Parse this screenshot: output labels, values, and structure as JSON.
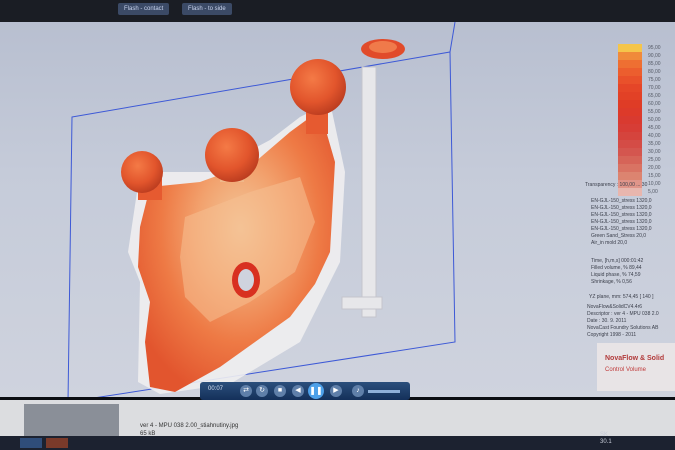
{
  "toolbar": {
    "btn1": "Flash - contact",
    "btn2": "Flash - to side"
  },
  "legend": {
    "values": [
      "95,00",
      "90,00",
      "85,00",
      "80,00",
      "75,00",
      "70,00",
      "65,00",
      "60,00",
      "55,00",
      "50,00",
      "45,00",
      "40,00",
      "35,00",
      "30,00",
      "25,00",
      "20,00",
      "15,00",
      "10,00",
      "5,00"
    ],
    "colors": [
      "#f5c54a",
      "#f08a3a",
      "#ee6f32",
      "#ec5e2e",
      "#e9512b",
      "#e54628",
      "#e24126",
      "#df3c26",
      "#dd3a2a",
      "#d93a30",
      "#d73d36",
      "#d5443d",
      "#d44c46",
      "#d4564f",
      "#d66458",
      "#d97363",
      "#dc8470",
      "#e0958a",
      "#e8b6ae"
    ]
  },
  "panel": {
    "transparency": "Transparency : 100,00  ... 30",
    "materials": [
      "EN-GJL-150_stress   1320,0",
      "EN-GJL-150_stress   1320,0",
      "EN-GJL-150_stress   1320,0",
      "EN-GJL-150_stress   1320,0",
      "EN-GJL-150_stress   1320,0",
      "Green Sand_Stress   20,0",
      "Air_in mold          20,0"
    ],
    "results": [
      "Time, [h,m,s]       000:01:42",
      "Filled volume, %     89,44",
      "Liquid phase, %      74,59",
      "Shrinkage, %          0,56"
    ],
    "plane": "YZ plane, mm: 574,45  [ 140 ]",
    "info": [
      "NovaFlow&SolidCV4.4r6",
      "Descriptor : ver 4 - MPU 038 2.0",
      "Date : 30. 9. 2011",
      "NovaCast Foundry Solutions AB",
      "Copyright 1998 - 2011"
    ]
  },
  "brand": {
    "title": "NovaFlow & Solid",
    "sub": "Control Volume"
  },
  "player": {
    "time": "00:07"
  },
  "file": {
    "name": "ver 4 - MPU 038 2.00_stiahnutiny.jpg",
    "size": "65 kB"
  },
  "clock": {
    "time": "SK",
    "date": "30.1"
  }
}
